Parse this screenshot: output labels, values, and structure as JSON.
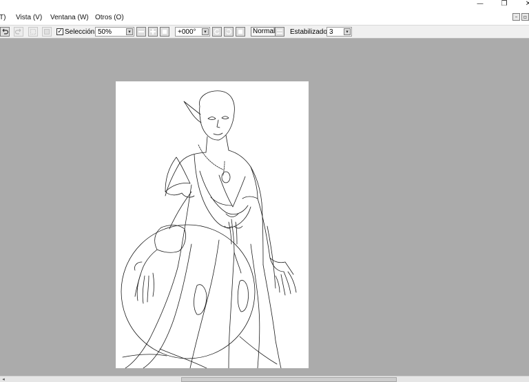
{
  "window": {
    "minimize_glyph": "—",
    "restore_glyph": "❐",
    "close_glyph": "✕"
  },
  "menubar": {
    "items": [
      {
        "label": "T)"
      },
      {
        "label": "Vista (V)"
      },
      {
        "label": "Ventana (W)"
      },
      {
        "label": "Otros (O)"
      }
    ],
    "mdi_minimize_glyph": "–",
    "mdi_restore_glyph": "▫"
  },
  "toolbar": {
    "undo_icon": "undo-icon",
    "redo_icon": "redo-icon",
    "selection_checked": true,
    "check_glyph": "✓",
    "selection_label": "Selección",
    "zoom_value": "50%",
    "rotation_value": "+000°",
    "blend_mode": "Normal",
    "stabilizer_label": "Estabilizador",
    "stabilizer_value": "3",
    "dropdown_glyph": "▾"
  },
  "colors": {
    "workspace_background": "#ababab",
    "canvas_background": "#ffffff",
    "lineart": "#1a1a1a"
  }
}
